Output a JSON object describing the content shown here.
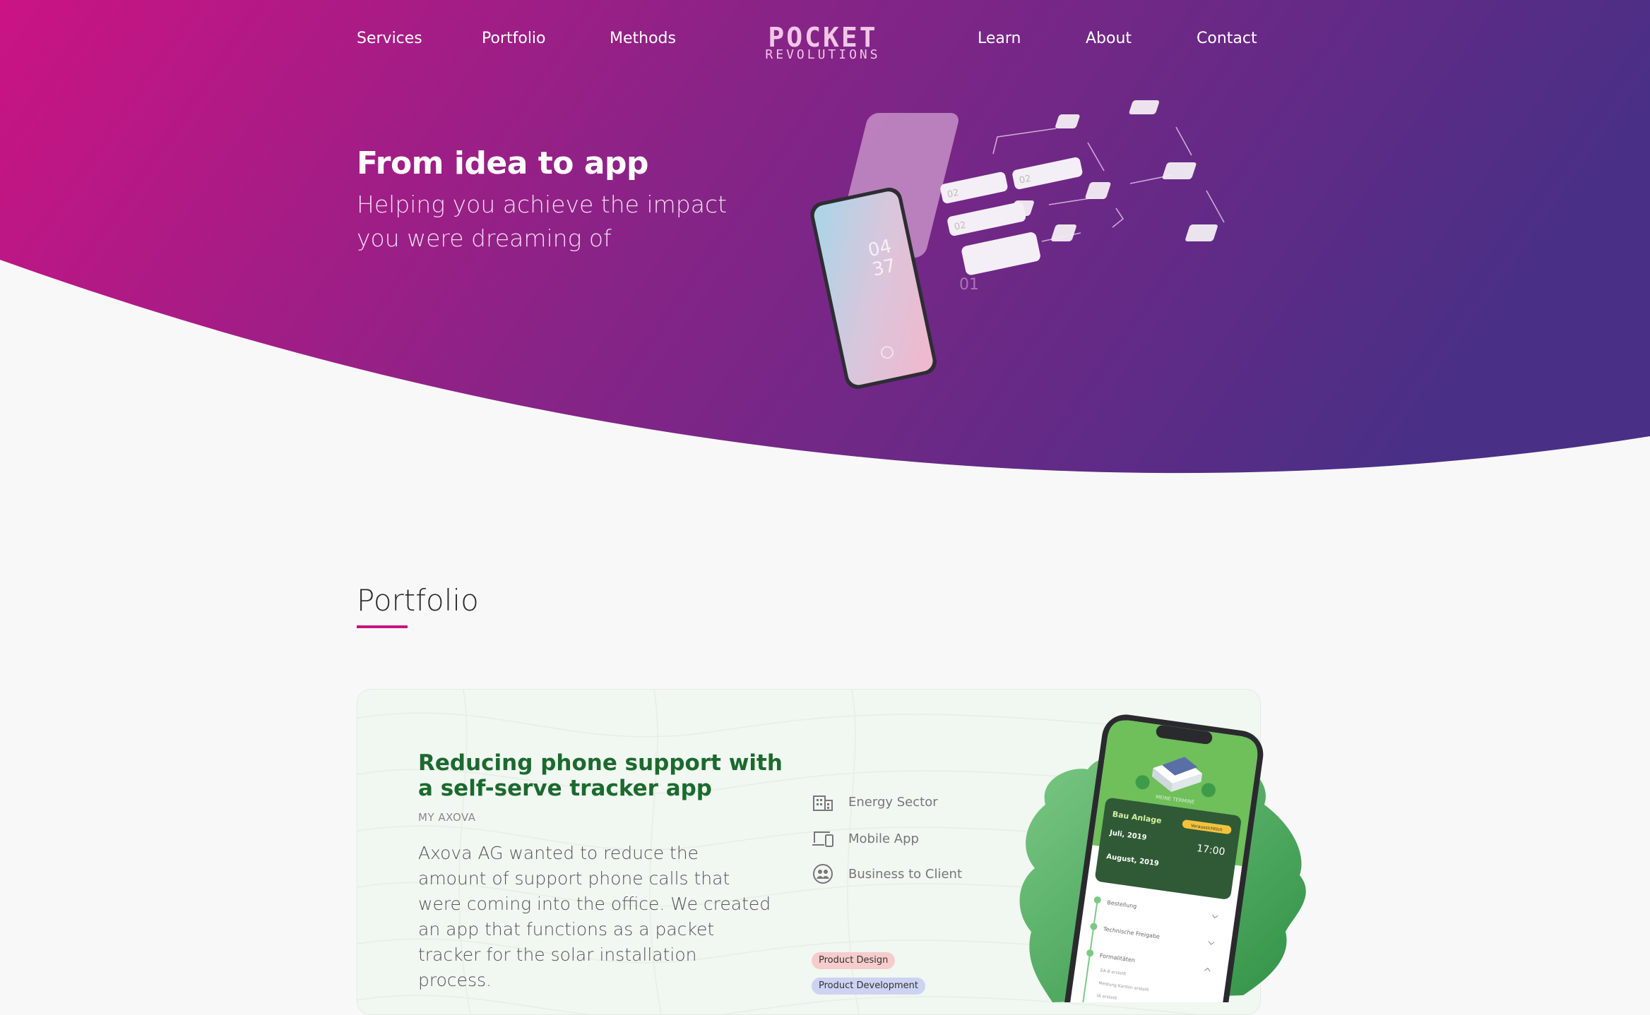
{
  "nav": {
    "services": "Services",
    "portfolio": "Portfolio",
    "methods": "Methods",
    "learn": "Learn",
    "about": "About",
    "contact": "Contact"
  },
  "logo": {
    "line1": "POCKET",
    "line2": "REVOLUTIONS"
  },
  "hero": {
    "title": "From idea to app",
    "subtitle": "Helping you achieve the impact you were dreaming of",
    "illustration_cards": [
      "02",
      "02",
      "02",
      "01"
    ],
    "phone_time": [
      "04",
      "37"
    ]
  },
  "portfolio": {
    "heading": "Portfolio",
    "card": {
      "title": "Reducing phone support with a self-serve tracker app",
      "client": "MY AXOVA",
      "description": "Axova AG wanted to reduce the amount of support phone calls that were coming into the office. We created an app that functions as a packet tracker for the solar installation process.",
      "meta": [
        {
          "icon": "building-icon",
          "label": "Energy Sector"
        },
        {
          "icon": "devices-icon",
          "label": "Mobile App"
        },
        {
          "icon": "people-icon",
          "label": "Business to Client"
        }
      ],
      "tags": [
        {
          "label": "Product Design",
          "color": "#f7cccc"
        },
        {
          "label": "Product Development",
          "color": "#cdd3f2"
        }
      ],
      "app_screen": {
        "header": "MEINE TERMINE",
        "project": "Bau Anlage",
        "badge": "Voraussichtlich",
        "date_from": "Juli, 2019",
        "time": "17:00",
        "date_to": "August, 2019",
        "steps": [
          "Bestellung",
          "Technische Freigabe",
          "Formalitäten"
        ],
        "substeps": [
          "EA-8 erstellt",
          "Meldung Kanton erstellt",
          "IA erstellt"
        ]
      }
    }
  },
  "colors": {
    "brand_magenta": "#c7157f",
    "brand_purple": "#4e2f86",
    "card_green": "#1b6a2e"
  }
}
